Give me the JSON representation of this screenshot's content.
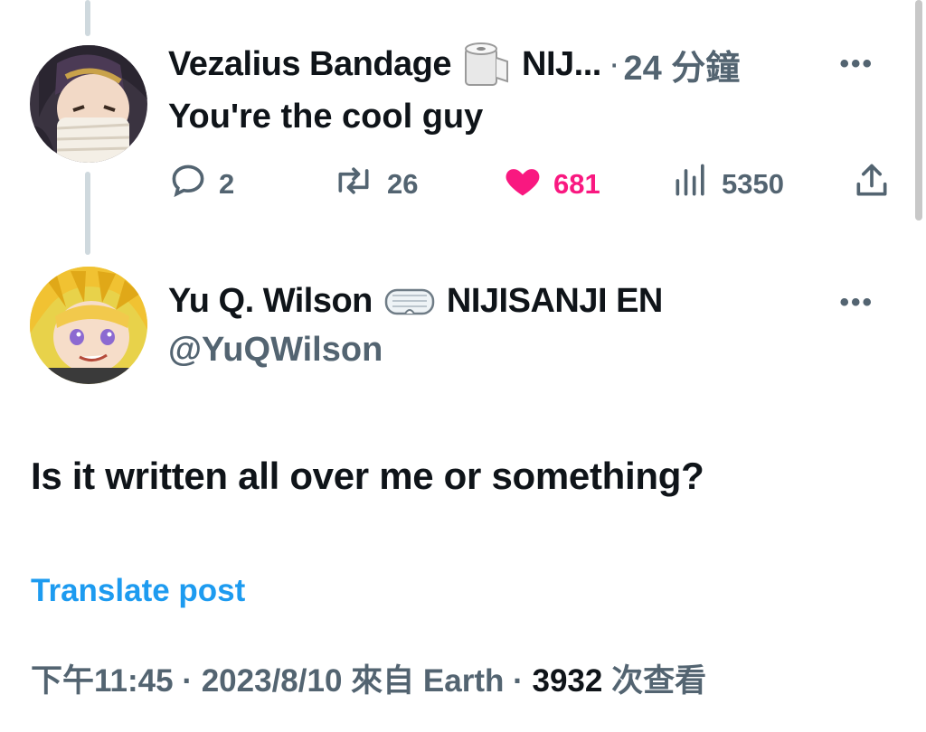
{
  "reply": {
    "author_name": "Vezalius Bandage",
    "author_name_suffix": "NIJ...",
    "separator": "·",
    "time_ago": "24 分鐘",
    "emoji": "toilet-paper-icon",
    "more_label": "•••",
    "text": "You're the cool guy",
    "stats": {
      "replies": "2",
      "reposts": "26",
      "likes": "681",
      "views": "5350"
    }
  },
  "post": {
    "author_name": "Yu Q. Wilson",
    "author_name_suffix": "NIJISANJI EN",
    "emoji": "goggles-icon",
    "handle": "@YuQWilson",
    "more_label": "•••",
    "text": "Is it written all over me or something?",
    "translate_label": "Translate post",
    "meta": {
      "time": "下午11:45",
      "date": "2023/8/10",
      "from": "來自 Earth",
      "views_count": "3932",
      "views_label": "次查看",
      "separator": "·"
    }
  },
  "colors": {
    "like": "#f91880",
    "link": "#1d9bf0",
    "muted": "#536471",
    "text": "#0f1419",
    "thread_line": "#cfd9de"
  }
}
